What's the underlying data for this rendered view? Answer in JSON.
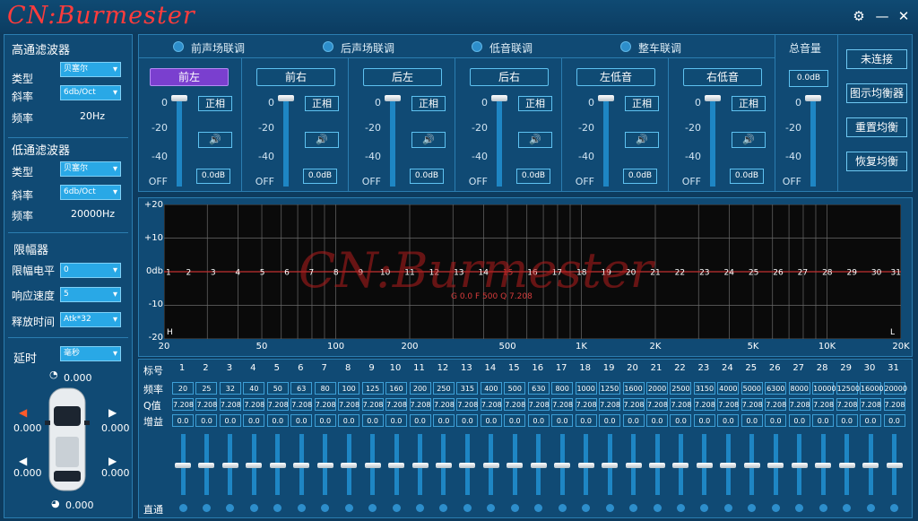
{
  "app": {
    "logo": "CN:Burmester"
  },
  "titlebar": {
    "settings_icon": "gear-icon",
    "minimize_icon": "minimize-icon",
    "close_icon": "close-icon"
  },
  "highpass": {
    "title": "高通滤波器",
    "type_label": "类型",
    "type_value": "贝塞尔",
    "slope_label": "斜率",
    "slope_value": "6db/Oct",
    "freq_label": "频率",
    "freq_value": "20Hz"
  },
  "lowpass": {
    "title": "低通滤波器",
    "type_label": "类型",
    "type_value": "贝塞尔",
    "slope_label": "斜率",
    "slope_value": "6db/Oct",
    "freq_label": "频率",
    "freq_value": "20000Hz"
  },
  "limiter": {
    "title": "限幅器",
    "level_label": "限幅电平",
    "level_value": "0",
    "speed_label": "响应速度",
    "speed_value": "5",
    "release_label": "释放时间",
    "release_value": "Atk*32"
  },
  "delay": {
    "label": "延时",
    "unit_value": "毫秒",
    "values": {
      "top": "0.000",
      "left_front": "0.000",
      "right_front": "0.000",
      "left_rear": "0.000",
      "right_rear": "0.000",
      "bottom": "0.000"
    }
  },
  "links": [
    "前声场联调",
    "后声场联调",
    "低音联调",
    "整车联调"
  ],
  "channels": [
    {
      "name": "前左",
      "phase": "正相",
      "gain": "0.0dB",
      "active": true
    },
    {
      "name": "前右",
      "phase": "正相",
      "gain": "0.0dB",
      "active": false
    },
    {
      "name": "后左",
      "phase": "正相",
      "gain": "0.0dB",
      "active": false
    },
    {
      "name": "后右",
      "phase": "正相",
      "gain": "0.0dB",
      "active": false
    },
    {
      "name": "左低音",
      "phase": "正相",
      "gain": "0.0dB",
      "active": false
    },
    {
      "name": "右低音",
      "phase": "正相",
      "gain": "0.0dB",
      "active": false
    }
  ],
  "master": {
    "label": "总音量",
    "gain": "0.0dB"
  },
  "scale": [
    "0",
    "-20",
    "-40",
    "OFF"
  ],
  "right_buttons": [
    "未连接",
    "图示均衡器",
    "重置均衡",
    "恢复均衡"
  ],
  "graph": {
    "y_labels": [
      "+20",
      "+10",
      "0db",
      "-10",
      "-20"
    ],
    "x_labels": [
      "20",
      "50",
      "100",
      "200",
      "500",
      "1K",
      "2K",
      "5K",
      "10K",
      "20K"
    ],
    "band_markers": [
      "1",
      "2",
      "3",
      "4",
      "5",
      "6",
      "7",
      "8",
      "9",
      "10",
      "11",
      "12",
      "13",
      "14",
      "15",
      "16",
      "17",
      "18",
      "19",
      "20",
      "21",
      "22",
      "23",
      "24",
      "25",
      "26",
      "27",
      "28",
      "29",
      "30",
      "31"
    ],
    "info": "G 0.0 F 500 Q 7.208",
    "h_marker": "H",
    "l_marker": "L",
    "watermark": "CN:Burmester"
  },
  "eq": {
    "labels": {
      "index": "标号",
      "freq": "频率",
      "q": "Q值",
      "gain": "增益",
      "bypass": "直通"
    },
    "freqs": [
      "20",
      "25",
      "32",
      "40",
      "50",
      "63",
      "80",
      "100",
      "125",
      "160",
      "200",
      "250",
      "315",
      "400",
      "500",
      "630",
      "800",
      "1000",
      "1250",
      "1600",
      "2000",
      "2500",
      "3150",
      "4000",
      "5000",
      "6300",
      "8000",
      "10000",
      "12500",
      "16000",
      "20000"
    ],
    "q": "7.208",
    "gain": "0.0"
  },
  "colors": {
    "accent": "#29a8e6",
    "active": "#7a3fcf",
    "speaker_active": "#ff5a2a"
  }
}
